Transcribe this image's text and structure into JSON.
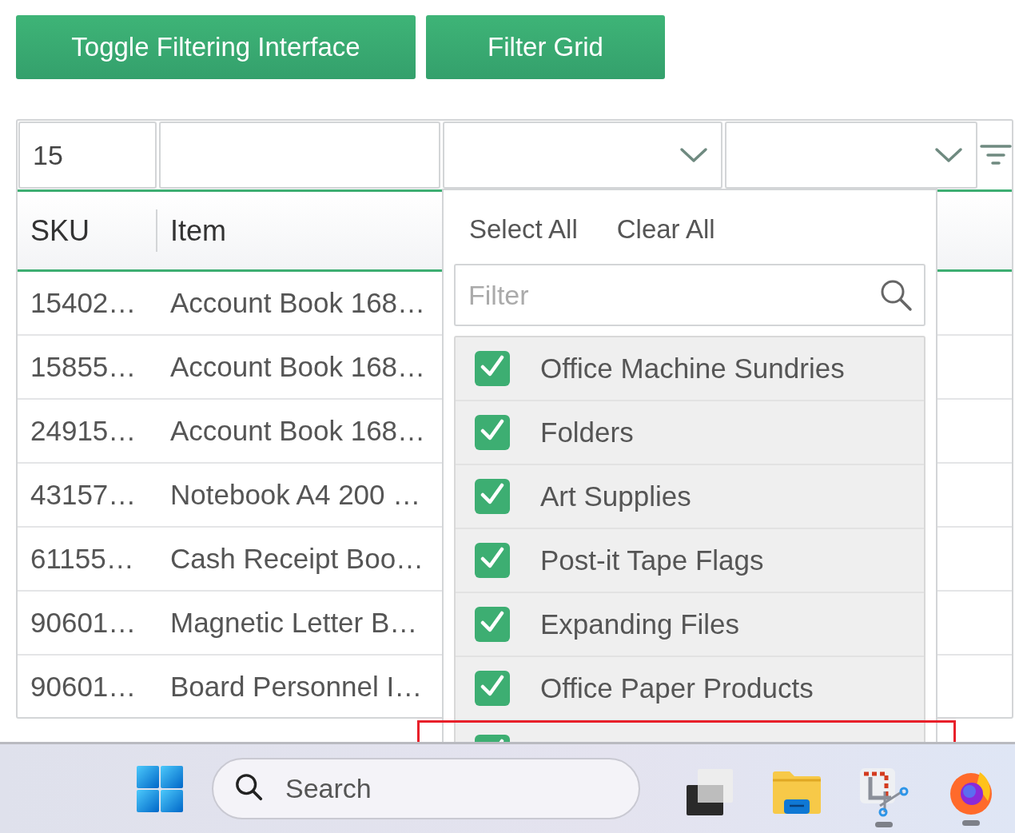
{
  "buttons": [
    {
      "label": "Toggle Filtering Interface"
    },
    {
      "label": "Filter Grid"
    }
  ],
  "filter_row": {
    "sku": "15"
  },
  "columns": [
    "SKU",
    "Item"
  ],
  "rows": [
    {
      "sku": "15402…",
      "item": "Account Book 168…"
    },
    {
      "sku": "15855…",
      "item": "Account Book 168…"
    },
    {
      "sku": "24915…",
      "item": "Account Book 168…"
    },
    {
      "sku": "43157…",
      "item": "Notebook A4 200 …"
    },
    {
      "sku": "61155…",
      "item": "Cash Receipt Boo…"
    },
    {
      "sku": "90601…",
      "item": "Magnetic Letter B…"
    },
    {
      "sku": "90601…",
      "item": "Board Personnel I…"
    }
  ],
  "dropdown": {
    "select_all": "Select All",
    "clear_all": "Clear All",
    "filter_placeholder": "Filter",
    "options": [
      {
        "label": "Office Machine Sundries",
        "checked": true
      },
      {
        "label": "Folders",
        "checked": true
      },
      {
        "label": "Art Supplies",
        "checked": true
      },
      {
        "label": "Post-it Tape Flags",
        "checked": true
      },
      {
        "label": "Expanding Files",
        "checked": true
      },
      {
        "label": "Office Paper Products",
        "checked": true
      },
      {
        "checked": true
      }
    ]
  },
  "taskbar": {
    "search_placeholder": "Search",
    "apps": [
      {
        "kind": "task-view",
        "running": false
      },
      {
        "kind": "explorer",
        "running": false
      },
      {
        "kind": "snipping",
        "running": true
      },
      {
        "kind": "firefox",
        "running": true
      }
    ]
  }
}
